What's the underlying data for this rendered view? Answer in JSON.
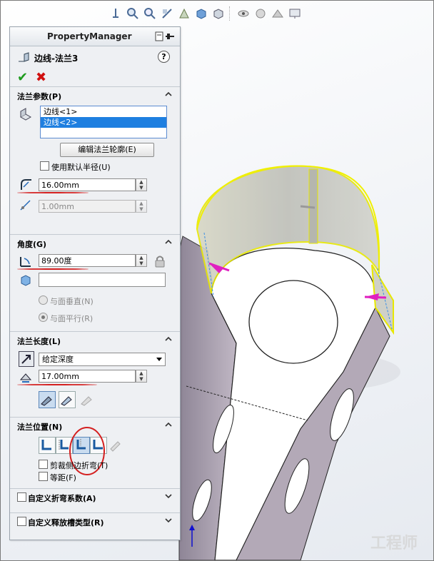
{
  "property_manager": {
    "header": "PropertyManager",
    "feature_title": "边线-法兰3",
    "help_label": "?"
  },
  "flange_params": {
    "title": "法兰参数(P)",
    "edges": [
      "边线<1>",
      "边线<2>"
    ],
    "selected_edge_index": 1,
    "edit_profile_button": "编辑法兰轮廓(E)",
    "use_default_radius_label": "使用默认半径(U)",
    "radius_value": "16.00mm",
    "gap_value": "1.00mm"
  },
  "angle": {
    "title": "角度(G)",
    "angle_value": "89.00度",
    "reference_value": "",
    "perpendicular_label": "与面垂直(N)",
    "parallel_label": "与面平行(R)",
    "selected_option": "parallel"
  },
  "flange_length": {
    "title": "法兰长度(L)",
    "end_condition": "给定深度",
    "length_value": "17.00mm"
  },
  "flange_position": {
    "title": "法兰位置(N)",
    "active_position_index": 2,
    "trim_side_bends_label": "剪裁侧边折弯(T)",
    "offset_label": "等距(F)"
  },
  "custom_bend_allowance": {
    "title": "自定义折弯系数(A)"
  },
  "custom_relief": {
    "title": "自定义释放槽类型(R)"
  },
  "watermark": "工程师",
  "colors": {
    "selection": "#1e7fe0",
    "ok": "#1e9b1e",
    "cancel": "#d01010",
    "annotation": "#d42020",
    "preview": "#f0f000",
    "part_face": "#b3a9b7"
  },
  "toolbar_icons": [
    "zoom-to-fit-icon",
    "zoom-to-area-icon",
    "previous-view-icon",
    "section-view-icon",
    "dynamic-annotation-icon",
    "view-orientation-icon",
    "display-style-icon",
    "hide-show-items-icon",
    "edit-appearance-icon",
    "apply-scene-icon",
    "view-settings-icon"
  ]
}
